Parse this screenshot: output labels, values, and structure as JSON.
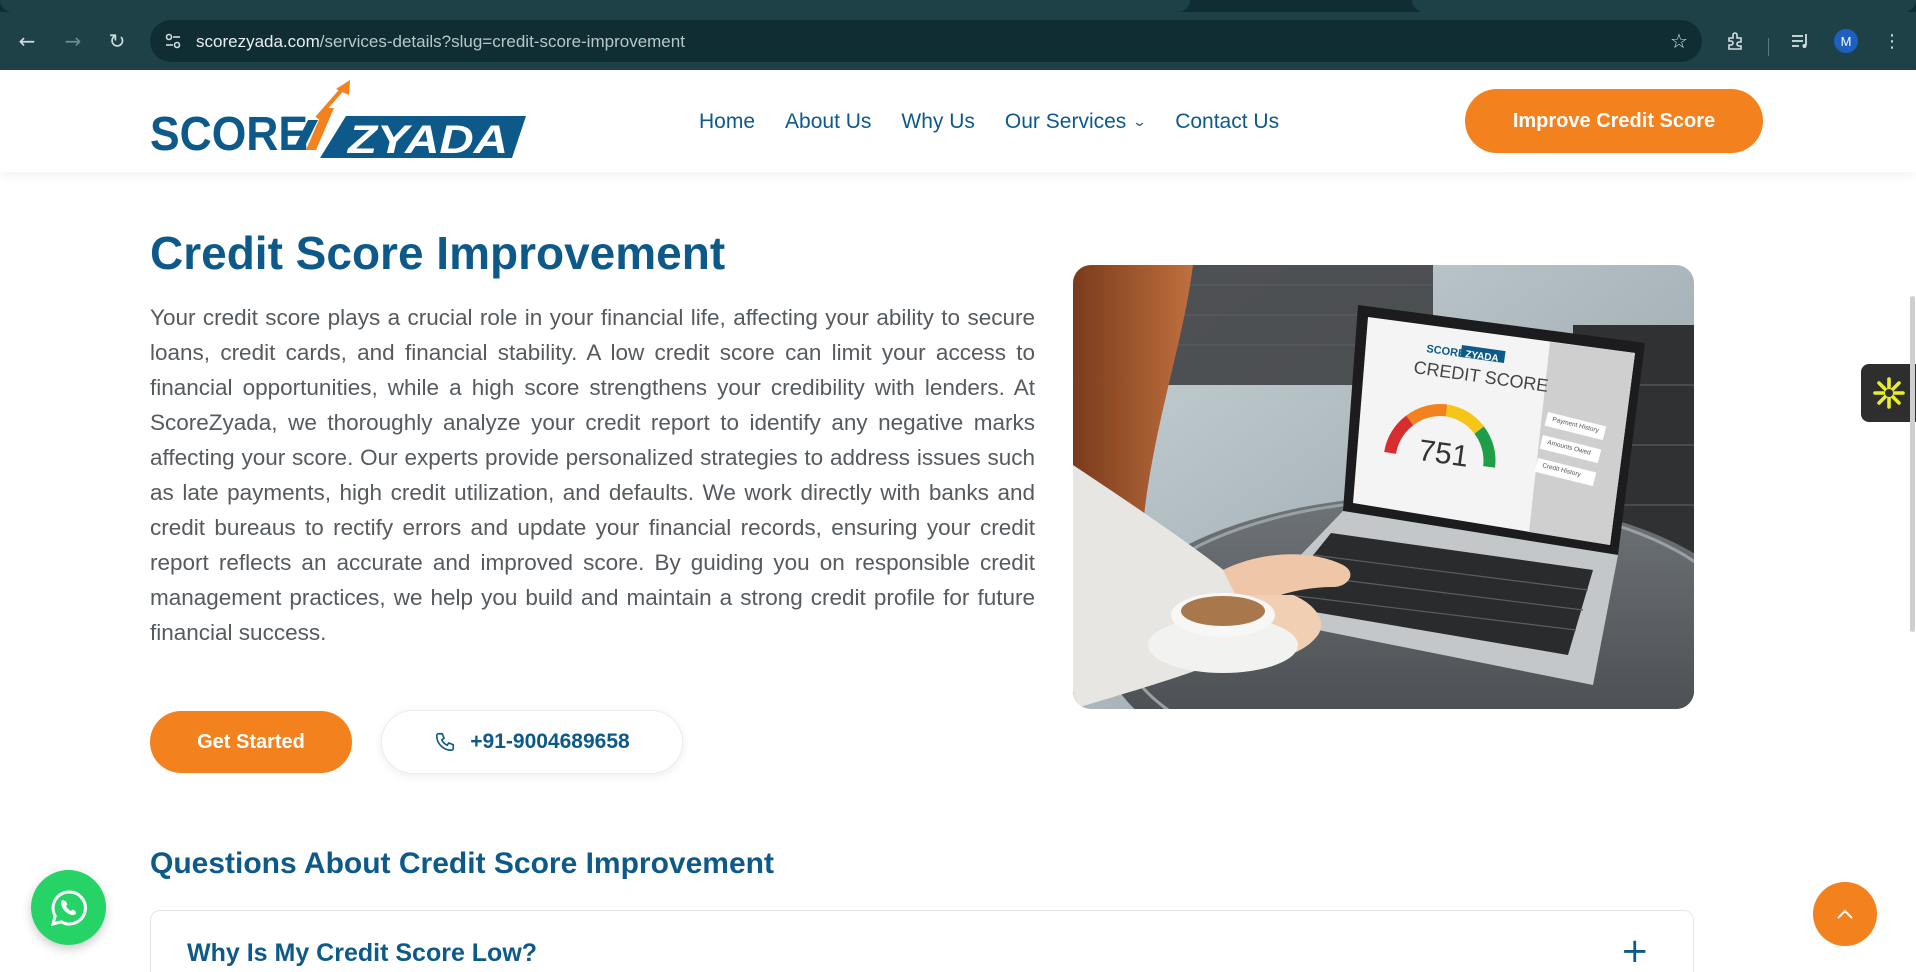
{
  "browser": {
    "url_domain": "scorezyada.com",
    "url_path": "/services-details?slug=credit-score-improvement",
    "profile_initial": "M"
  },
  "header": {
    "logo_text_left": "SCORE",
    "logo_text_right": "ZYADA",
    "nav": [
      {
        "label": "Home"
      },
      {
        "label": "About Us"
      },
      {
        "label": "Why Us"
      },
      {
        "label": "Our Services"
      },
      {
        "label": "Contact Us"
      }
    ],
    "cta_label": "Improve Credit Score"
  },
  "main": {
    "title": "Credit Score Improvement",
    "intro": "Your credit score plays a crucial role in your financial life, affecting your ability to secure loans, credit cards, and financial stability. A low credit score can limit your access to financial opportunities, while a high score strengthens your credibility with lenders. At ScoreZyada, we thoroughly analyze your credit report to identify any negative marks affecting your score. Our experts provide personalized strategies to address issues such as late payments, high credit utilization, and defaults. We work directly with banks and credit bureaus to rectify errors and update your financial records, ensuring your credit report reflects an accurate and improved score. By guiding you on responsible credit management practices, we help you build and maintain a strong credit profile for future financial success.",
    "get_started_label": "Get Started",
    "phone_label": "+91-9004689658",
    "image": {
      "screen_brand_left": "SCORE",
      "screen_brand_right": "ZYADA",
      "screen_heading": "CREDIT SCORE",
      "score_value": "751",
      "side_items": [
        "Payment History",
        "Amounts Owed",
        "Credit History"
      ]
    }
  },
  "faq": {
    "title": "Questions About Credit Score Improvement",
    "items": [
      {
        "question": "Why Is My Credit Score Low?"
      }
    ]
  },
  "colors": {
    "brand_blue": "#0d5a8a",
    "brand_orange": "#f2811e",
    "whatsapp_green": "#25d366",
    "chrome_dark": "#1e4148"
  }
}
